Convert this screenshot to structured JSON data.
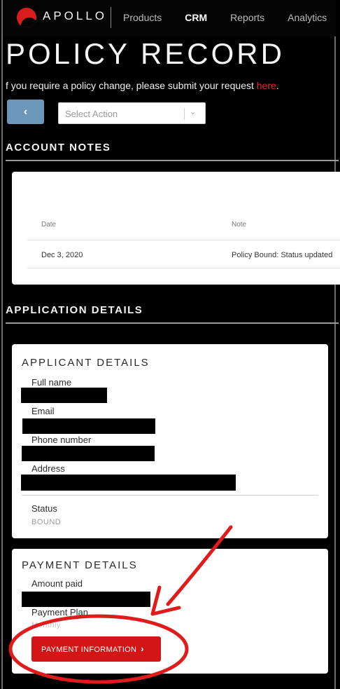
{
  "header": {
    "brand": "APOLLO",
    "nav": [
      "Products",
      "CRM",
      "Reports",
      "Analytics"
    ],
    "active_nav": "CRM"
  },
  "page": {
    "title": "POLICY RECORD",
    "notice_prefix": "f you require a policy change, please submit your request ",
    "notice_link": "here",
    "notice_suffix": "."
  },
  "toolbar": {
    "back_label": "‹",
    "select_placeholder": "Select Action"
  },
  "account_notes": {
    "heading": "ACCOUNT NOTES",
    "columns": [
      "Date",
      "Note"
    ],
    "rows": [
      {
        "date": "Dec 3, 2020",
        "note": "Policy Bound: Status updated"
      }
    ]
  },
  "application_details": {
    "heading": "APPLICATION DETAILS",
    "applicant": {
      "title": "APPLICANT DETAILS",
      "full_name_label": "Full name",
      "email_label": "Email",
      "phone_label": "Phone number",
      "address_label": "Address",
      "status_label": "Status",
      "status_value": "BOUND"
    },
    "payment": {
      "title": "PAYMENT DETAILS",
      "amount_label": "Amount paid",
      "plan_label": "Payment Plan",
      "plan_value": "Monthly",
      "button_label": "PAYMENT INFORMATION"
    }
  },
  "colors": {
    "accent_red": "#d31515",
    "back_button": "#6b97b8",
    "annotation_red": "#e01b1b"
  }
}
